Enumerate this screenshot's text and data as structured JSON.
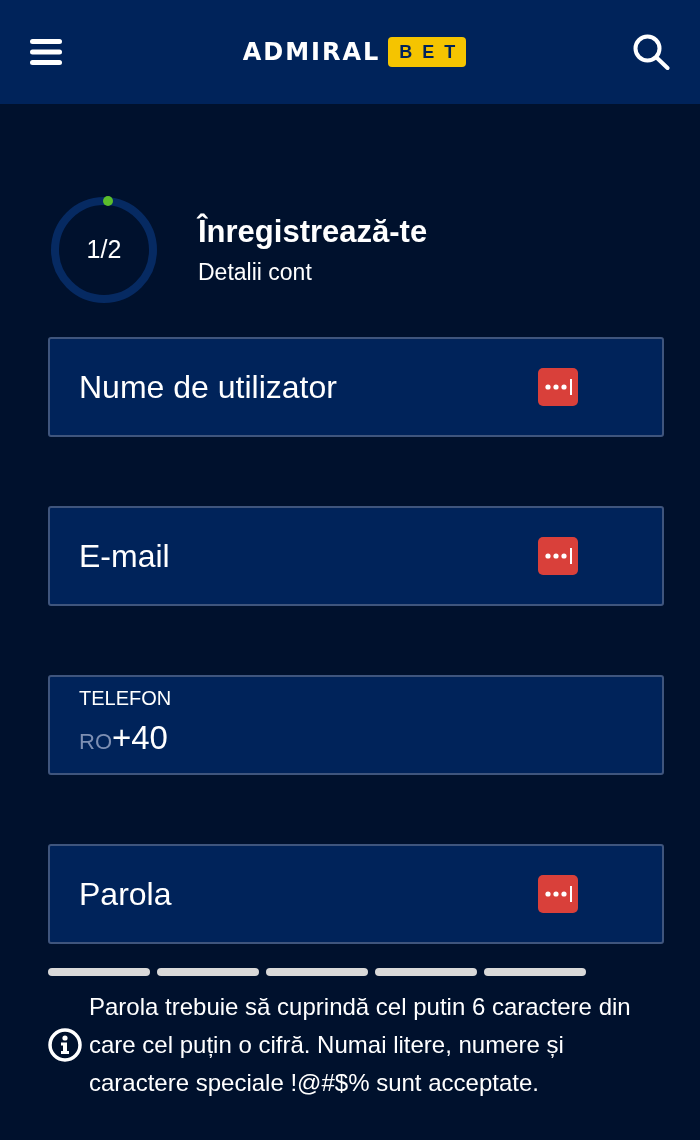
{
  "header": {
    "logo": {
      "text": "ADMIRAL",
      "badge": "BET"
    }
  },
  "progress": {
    "step": "1/2",
    "title": "Înregistrează-te",
    "subtitle": "Detalii cont"
  },
  "fields": [
    {
      "kind": "text",
      "placeholder": "Nume de utilizator",
      "autofill_icon": true
    },
    {
      "kind": "text",
      "placeholder": "E-mail",
      "autofill_icon": true
    },
    {
      "kind": "phone",
      "label": "TELEFON",
      "country": "RO",
      "value": "+40"
    },
    {
      "kind": "password",
      "placeholder": "Parola",
      "autofill_icon": true
    }
  ],
  "password_strength": {
    "segments": [
      {
        "filled": false
      },
      {
        "filled": false
      },
      {
        "filled": false
      },
      {
        "filled": false
      },
      {
        "filled": false
      }
    ]
  },
  "hint": {
    "text": "Parola trebuie să cuprindă cel putin 6 caractere din care cel puțin o cifră. Numai litere, numere și caractere speciale !@#$% sunt acceptate."
  }
}
